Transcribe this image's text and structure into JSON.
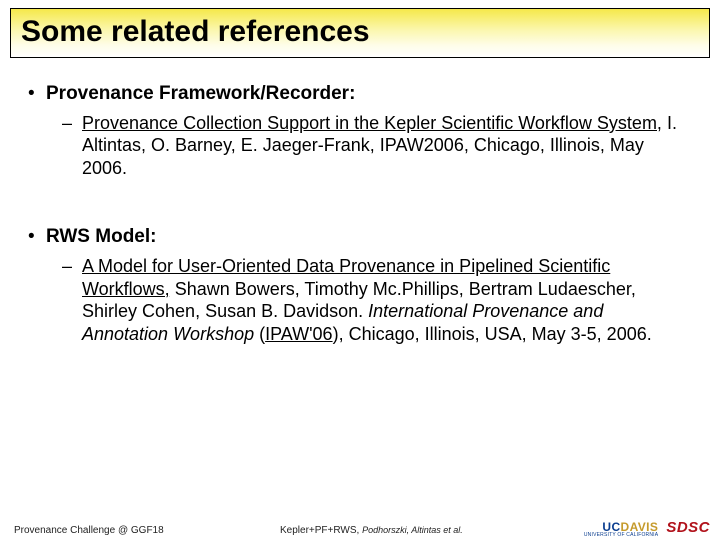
{
  "title": "Some related references",
  "sections": [
    {
      "heading": "Provenance Framework/Recorder:",
      "item_linked": "Provenance Collection Support in the Kepler Scientific Workflow System,",
      "item_rest": " I. Altintas, O. Barney, E. Jaeger-Frank, IPAW2006, Chicago, Illinois, May 2006."
    },
    {
      "heading": "RWS Model:",
      "item_linked": "A Model for User-Oriented Data Provenance in Pipelined Scientific Workflows,",
      "item_mid": " Shawn Bowers, Timothy Mc.Phillips, Bertram Ludaescher, Shirley Cohen, Susan B. Davidson. ",
      "item_venue": "International Provenance and Annotation Workshop",
      "item_paren_open": " (",
      "item_ipaw": "IPAW'06",
      "item_paren_close": ")",
      "item_tail": ", Chicago, Illinois, USA, May 3-5, 2006."
    }
  ],
  "footer": {
    "left": "Provenance Challenge @ GGF18",
    "mid_a": "Kepler+PF+RWS, ",
    "mid_b": "Podhorszki, Altintas et al."
  },
  "logos": {
    "uc": "UC",
    "davis": "DAVIS",
    "sub": "UNIVERSITY OF CALIFORNIA",
    "sdsc": "SDSC"
  }
}
